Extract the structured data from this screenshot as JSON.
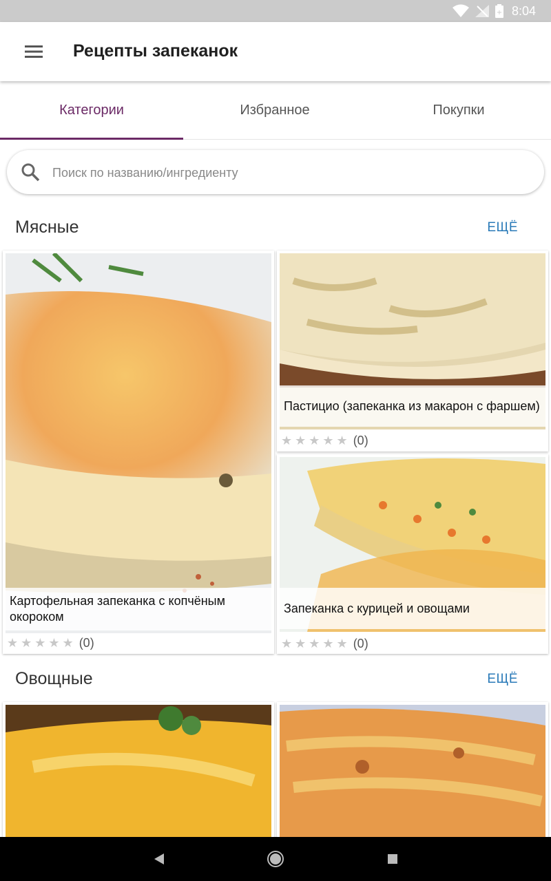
{
  "status_bar": {
    "time": "8:04"
  },
  "app_bar": {
    "title": "Рецепты запеканок"
  },
  "tabs": [
    {
      "label": "Категории",
      "active": true
    },
    {
      "label": "Избранное",
      "active": false
    },
    {
      "label": "Покупки",
      "active": false
    }
  ],
  "search": {
    "placeholder": "Поиск по названию/ингредиенту",
    "value": ""
  },
  "sections": [
    {
      "title": "Мясные",
      "more_label": "ЕЩЁ",
      "recipes": [
        {
          "title": "Картофельная запеканка с копчёным окороком",
          "stars": "★★★★★",
          "count": "(0)"
        },
        {
          "title": "Пастицио (запеканка из макарон с фаршем)",
          "stars": "★★★★★",
          "count": "(0)"
        },
        {
          "title": "Запеканка с курицей и овощами",
          "stars": "★★★★★",
          "count": "(0)"
        }
      ]
    },
    {
      "title": "Овощные",
      "more_label": "ЕЩЁ"
    }
  ],
  "colors": {
    "accent": "#6b2a66",
    "link": "#2a7ab8",
    "status_bar": "#cbcbcb"
  }
}
